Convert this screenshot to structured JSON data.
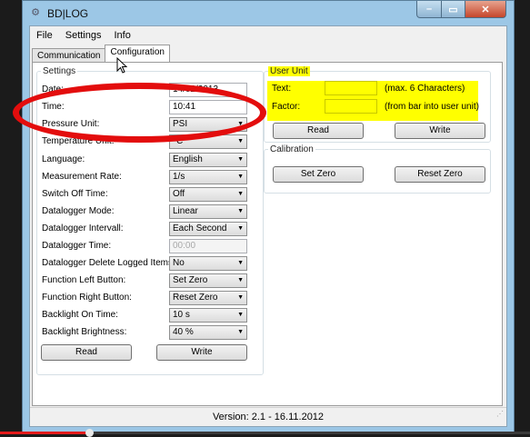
{
  "window": {
    "title": "BD|LOG",
    "buttons": {
      "min": "–",
      "max": "▭",
      "close": "✕"
    }
  },
  "menu": [
    "File",
    "Settings",
    "Info"
  ],
  "tabs": [
    {
      "label": "Communication"
    },
    {
      "label": "Configuration"
    }
  ],
  "settings": {
    "legend": "Settings",
    "rows": [
      {
        "label": "Date:",
        "value": "14/02/2013"
      },
      {
        "label": "Time:",
        "value": "10:41"
      },
      {
        "label": "Pressure Unit:",
        "value": "PSI"
      },
      {
        "label": "Temperature Unit:",
        "value": "°C"
      },
      {
        "label": "Language:",
        "value": "English"
      },
      {
        "label": "Measurement Rate:",
        "value": "1/s"
      },
      {
        "label": "Switch Off Time:",
        "value": "Off"
      },
      {
        "label": "Datalogger Mode:",
        "value": "Linear"
      },
      {
        "label": "Datalogger Intervall:",
        "value": "Each Second"
      },
      {
        "label": "Datalogger Time:",
        "value": "00:00"
      },
      {
        "label": "Datalogger Delete Logged Items:",
        "value": "No"
      },
      {
        "label": "Function Left Button:",
        "value": "Set Zero"
      },
      {
        "label": "Function Right Button:",
        "value": "Reset Zero"
      },
      {
        "label": "Backlight On Time:",
        "value": "10 s"
      },
      {
        "label": "Backlight Brightness:",
        "value": "40 %"
      }
    ],
    "read": "Read",
    "write": "Write"
  },
  "user_unit": {
    "legend": "User Unit",
    "text_label": "Text:",
    "text_value": "",
    "text_hint": "(max. 6 Characters)",
    "factor_label": "Factor:",
    "factor_value": "",
    "factor_hint": "(from bar into user unit)",
    "read": "Read",
    "write": "Write"
  },
  "calibration": {
    "legend": "Calibration",
    "set_zero": "Set Zero",
    "reset_zero": "Reset Zero"
  },
  "status": {
    "version": "Version: 2.1 - 16.11.2012"
  },
  "video": {
    "progress_percent": 17
  },
  "colors": {
    "highlight": "#ffff00",
    "annotation_ellipse": "#e30d0d",
    "title_bar": "#9cc7e6"
  }
}
